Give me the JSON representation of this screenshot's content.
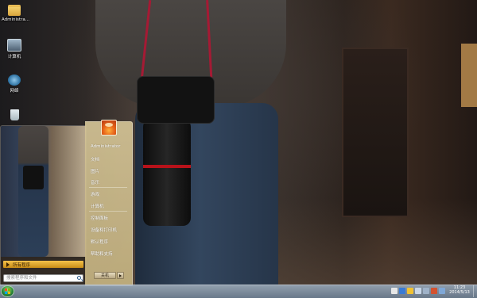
{
  "desktop": {
    "icons": [
      {
        "label": "Administra...",
        "icon": "user-folder-icon"
      },
      {
        "label": "计算机",
        "icon": "computer-icon"
      },
      {
        "label": "网络",
        "icon": "network-icon"
      },
      {
        "label": "",
        "icon": "recycle-bin-icon"
      }
    ]
  },
  "start_menu": {
    "user_name": "Administrator",
    "items": [
      "文档",
      "图片",
      "音乐",
      "游戏",
      "计算机",
      "控制面板",
      "设备和打印机",
      "默认程序",
      "帮助和支持"
    ],
    "all_programs": "所有程序",
    "search_placeholder": "搜索程序和文件",
    "shutdown": "关机"
  },
  "taskbar": {
    "time": "11:23",
    "date": "2014/5/13",
    "colors": {
      "accent": "#c98d17",
      "start_orb": "#2d8a3a"
    }
  }
}
